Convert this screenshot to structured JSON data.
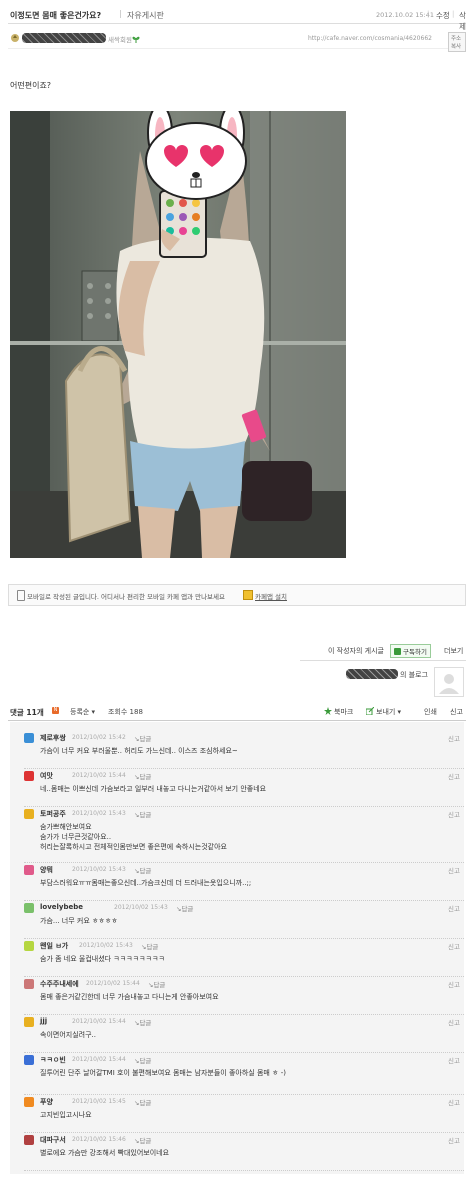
{
  "post": {
    "title": "이정도면 몸매 좋은건가요?",
    "board": "자유게시판",
    "date": "2012.10.02 15:41",
    "edit_label": "수정",
    "delete_label": "삭제",
    "author_tag": "새싹회원",
    "url": "http://cafe.naver.com/cosmania/4620662",
    "addr_copy_label": "주소복사",
    "body": "어떤편이죠?"
  },
  "mobile_bar": {
    "text": "모바일로 작성된 글입니다. 어디서나 편리한 모바일 카페 앱과 만나보세요",
    "app_link": "카페앱 설치"
  },
  "author_box": {
    "posts_label": "이 작성자의 게시글",
    "subscribe_label": "구독하기",
    "more_label": "더보기",
    "blog_suffix": "의 블로그"
  },
  "comment_bar": {
    "count": "댓글 11개",
    "new_badge": "N",
    "order": "등록순 ▾",
    "views": "조회수 188",
    "bookmark": "북마크",
    "send": "보내기 ▾",
    "print": "인쇄",
    "report": "신고"
  },
  "comments": [
    {
      "nick": "제로후쌍",
      "date": "2012/10/02 15:42",
      "reply": "답글",
      "text": [
        "가슴이 너무 커요 부러울뿐.. 허리도 가느신데.. 이스즈 조심하세요~"
      ],
      "icon_color": "#3a8fd6"
    },
    {
      "nick": "여맛",
      "date": "2012/10/02 15:44",
      "reply": "답글",
      "text": [
        "네..몸매는 이쁘신데 가슴보라고 일부러 내놓고 다니는거같아서 보기 안좋네요"
      ],
      "icon_color": "#d33"
    },
    {
      "nick": "토퍼공주",
      "date": "2012/10/02 15:43",
      "reply": "답글",
      "text": [
        "숨가쁘해안보여요",
        "숨가가 너무큰것같아요..",
        "허리는잘록하시고 전체적인몸만보면 좋은편에 속하시는것같아요"
      ],
      "icon_color": "#e8b020"
    },
    {
      "nick": "양뭐",
      "date": "2012/10/02 15:43",
      "reply": "답글",
      "text": [
        "부담스러워요ㅠㅠ몸매는좋으신데..가슴크신데 더 드러내는옷입으니까..;;"
      ],
      "icon_color": "#e05a8a"
    },
    {
      "nick": "lovelybebe",
      "date": "2012/10/02 15:43",
      "reply": "답글",
      "text": [
        "가슴... 너무 커요 ㅎㅎㅎㅎ"
      ],
      "icon_color": "#7ac06a"
    },
    {
      "nick": "왠일 ㅂ가",
      "date": "2012/10/02 15:43",
      "reply": "답글",
      "text": [
        "숨가 좀 네요 울컵내셨다 ㅋㅋㅋㅋㅋㅋㅋㅋ"
      ],
      "icon_color": "#b5d640"
    },
    {
      "nick": "수주주내세에",
      "date": "2012/10/02 15:44",
      "reply": "답글",
      "text": [
        "몸매 좋은거같긴한데 너무 가슴내놓고 다니는게 안좋아보여요"
      ],
      "icon_color": "#c77"
    },
    {
      "nick": "jjj",
      "date": "2012/10/02 15:44",
      "reply": "답글",
      "text": [
        "속이면어지실려구.."
      ],
      "icon_color": "#e8b020"
    },
    {
      "nick": "ㅋㅋㅇ빈",
      "date": "2012/10/02 15:44",
      "reply": "답글",
      "text": [
        "질투어린 단주 날어갈TMI 호이 불편해보여요 몸매는 남자분들이 좋아하실 몸매 ㅎ -)"
      ],
      "icon_color": "#3a6fd6"
    },
    {
      "nick": "푸양",
      "date": "2012/10/02 15:45",
      "reply": "답글",
      "text": [
        "고지빈입고시나요"
      ],
      "icon_color": "#f08a20"
    },
    {
      "nick": "대파구서",
      "date": "2012/10/02 15:46",
      "reply": "답글",
      "text": [
        "별로에요 가슴만 강조해서 빡대있어보이네요"
      ],
      "icon_color": "#b04040"
    }
  ],
  "report_label": "신고",
  "colors": {
    "accent": "#e86a2a",
    "green": "#3a9a3a",
    "link": "#3a6fd6"
  }
}
